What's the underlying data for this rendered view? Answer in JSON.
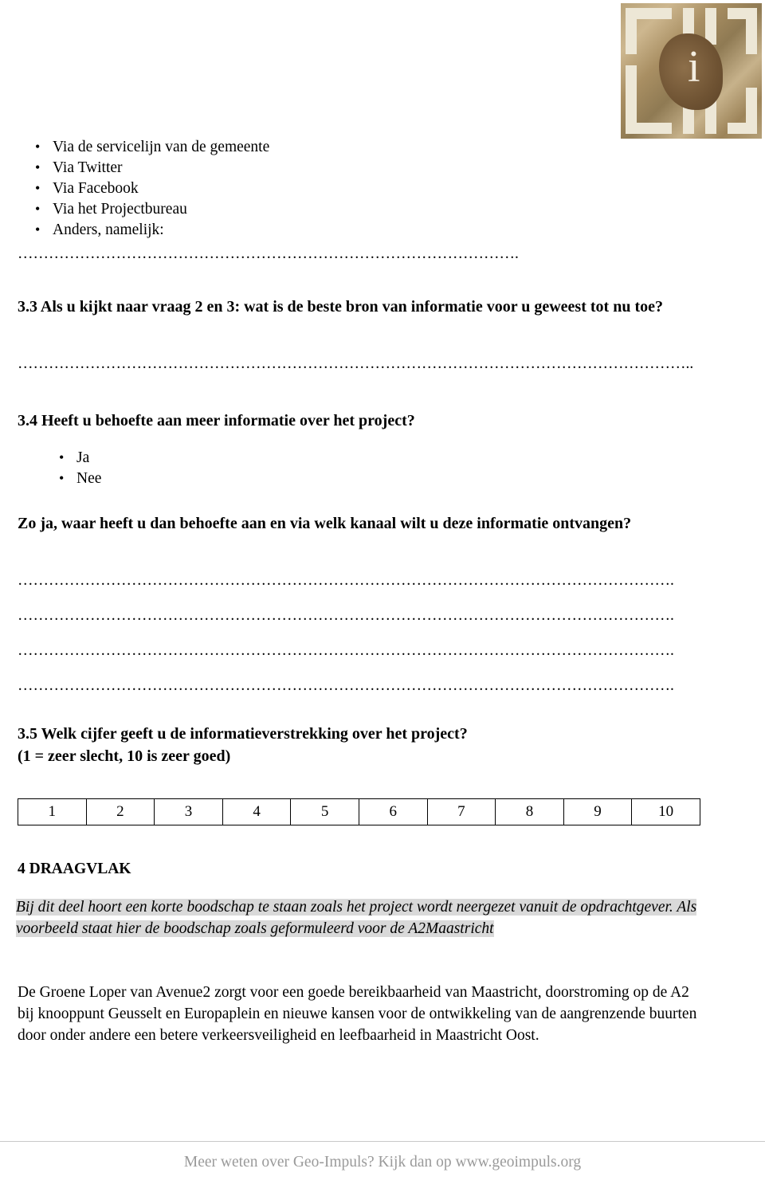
{
  "logo": {
    "name": "geo-impuls-logo",
    "letter": "i"
  },
  "list_channels": {
    "items": [
      "Via de servicelijn van de gemeente",
      "Via Twitter",
      "Via Facebook",
      "Via het Projectbureau",
      "Anders, namelijk:"
    ],
    "dots": "……………………………………………………………………………………."
  },
  "q33": {
    "text": "3.3 Als u kijkt naar vraag 2 en 3: wat is de beste bron van informatie voor u geweest tot nu toe?",
    "dots": "………………………………………………………………………………………………………………….."
  },
  "q34": {
    "text": "3.4 Heeft u behoefte aan meer informatie over het project?",
    "options": [
      "Ja",
      "Nee"
    ],
    "follow_up": "Zo ja, waar heeft u dan behoefte aan en via welk kanaal wilt u deze informatie ontvangen?",
    "dots": [
      "……………………………………………………………………………………………………………….",
      "……………………………………………………………………………………………………………….",
      "……………………………………………………………………………………………………………….",
      "………………………………………………………………………………………………………………."
    ]
  },
  "q35": {
    "line1": "3.5 Welk cijfer geeft u de informatieverstrekking over het project?",
    "line2": "(1 = zeer slecht, 10 is zeer goed)",
    "scale": [
      "1",
      "2",
      "3",
      "4",
      "5",
      "6",
      "7",
      "8",
      "9",
      "10"
    ]
  },
  "section4": {
    "heading": "4 DRAAGVLAK",
    "italic_intro_a": "Bij dit deel hoort een korte boodschap te staan zoals het project wordt neergezet vanuit de opdrachtgever.",
    "italic_intro_b": " Als voorbeeld staat hier de boodschap zoals geformuleerd voor de ",
    "italic_intro_c": "A2Maastricht",
    "body": "De Groene Loper van Avenue2 zorgt voor een goede bereikbaarheid van Maastricht, doorstroming op de A2 bij knooppunt Geusselt en Europaplein en nieuwe kansen voor de ontwikkeling van de aangrenzende buurten door onder andere een betere verkeersveiligheid en leefbaarheid in Maastricht Oost."
  },
  "footer": {
    "text": "Meer weten over Geo-Impuls? Kijk dan op www.geoimpuls.org",
    "color": "#9a9a9a"
  }
}
